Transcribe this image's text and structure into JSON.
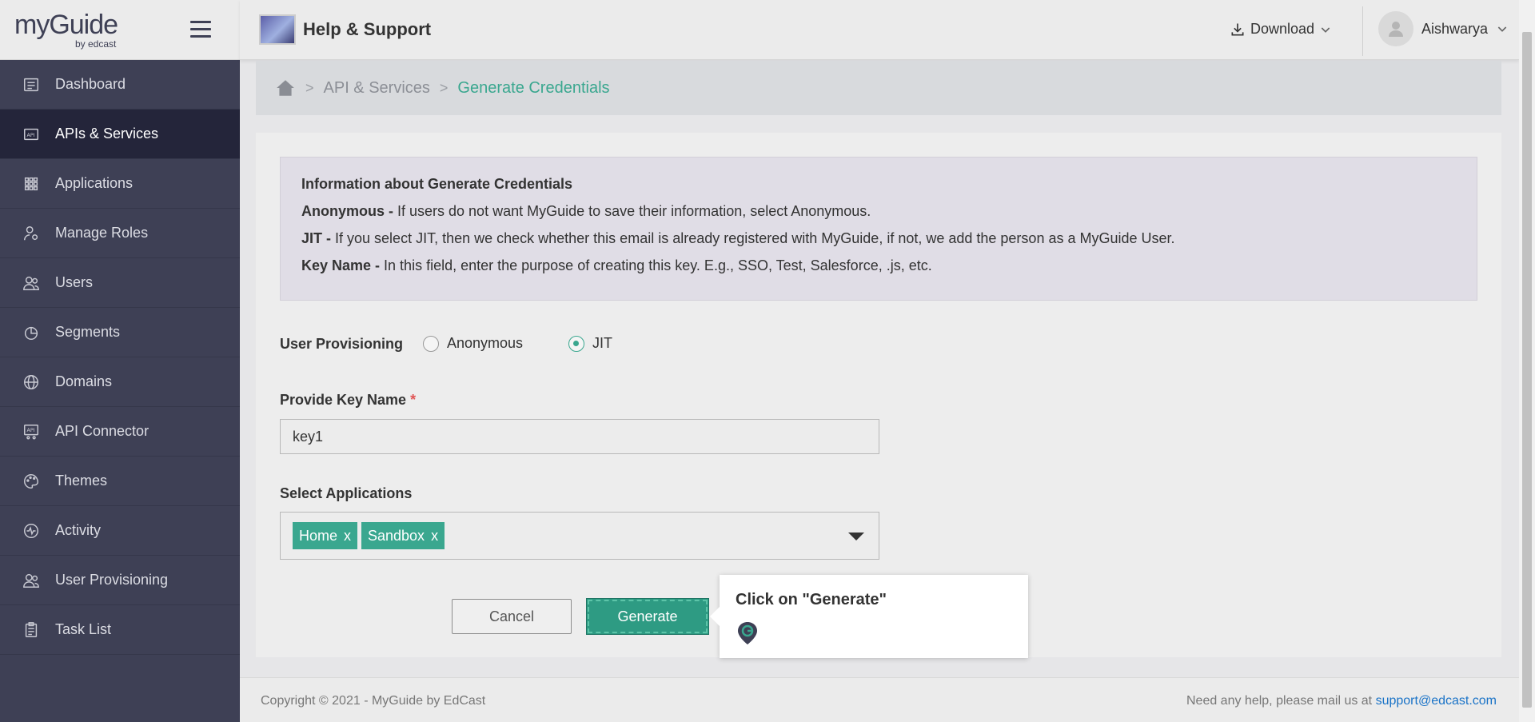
{
  "sidebar": {
    "logo_main": "myGuide",
    "logo_sub": "by edcast",
    "items": [
      {
        "label": "Dashboard",
        "icon": "dashboard-icon"
      },
      {
        "label": "APIs & Services",
        "icon": "api-icon",
        "active": true
      },
      {
        "label": "Applications",
        "icon": "grid-icon"
      },
      {
        "label": "Manage Roles",
        "icon": "user-gear-icon"
      },
      {
        "label": "Users",
        "icon": "users-icon"
      },
      {
        "label": "Segments",
        "icon": "pie-icon"
      },
      {
        "label": "Domains",
        "icon": "globe-icon"
      },
      {
        "label": "API Connector",
        "icon": "api-connector-icon"
      },
      {
        "label": "Themes",
        "icon": "palette-icon"
      },
      {
        "label": "Activity",
        "icon": "activity-icon"
      },
      {
        "label": "User Provisioning",
        "icon": "users-icon"
      },
      {
        "label": "Task List",
        "icon": "clipboard-icon"
      }
    ]
  },
  "header": {
    "title": "Help & Support",
    "download_label": "Download",
    "user_name": "Aishwarya"
  },
  "breadcrumb": {
    "items": [
      "API & Services",
      "Generate Credentials"
    ]
  },
  "info": {
    "heading": "Information about Generate Credentials",
    "anon_term": "Anonymous -",
    "anon_text": " If users do not want MyGuide to save their information, select Anonymous.",
    "jit_term": "JIT -",
    "jit_text": " If you select JIT, then we check whether this email is already registered with MyGuide, if not, we add the person as a MyGuide User.",
    "key_term": "Key Name -",
    "key_text": " In this field, enter the purpose of creating this key. E.g., SSO, Test, Salesforce, .js, etc."
  },
  "form": {
    "provisioning_label": "User Provisioning",
    "radio_anonymous": "Anonymous",
    "radio_jit": "JIT",
    "selected_radio": "JIT",
    "key_name_label": "Provide Key Name",
    "required_mark": "*",
    "key_name_value": "key1",
    "apps_label": "Select Applications",
    "selected_apps": [
      "Home",
      "Sandbox"
    ],
    "tag_remove": "x",
    "cancel_label": "Cancel",
    "generate_label": "Generate"
  },
  "tooltip": {
    "text": "Click on \"Generate\""
  },
  "footer": {
    "copyright": "Copyright © 2021 - MyGuide by EdCast",
    "help_text": "Need any help, please mail us at ",
    "help_email": "support@edcast.com"
  },
  "colors": {
    "accent": "#3aa78f",
    "sidebar_bg": "#3e4055",
    "sidebar_active": "#24253a"
  }
}
